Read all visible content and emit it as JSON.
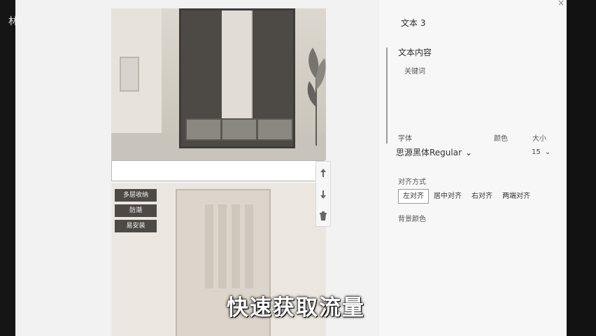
{
  "corner_text": "林杉",
  "panel": {
    "title": "文本 3",
    "content_section": "文本内容",
    "content_value": "关键词",
    "font_label": "字体",
    "color_label": "颜色",
    "size_label": "大小",
    "font_value": "思源黑体Regular",
    "size_value": "15",
    "align_label": "对齐方式",
    "align_options": [
      "左对齐",
      "居中对齐",
      "右对齐",
      "两端对齐"
    ],
    "background_label": "背景颜色"
  },
  "image_tags": [
    "多层收纳",
    "防潮",
    "易安装"
  ],
  "caption": "快速获取流量",
  "icons": {
    "close": "close-icon",
    "up": "up-arrow-icon",
    "down": "down-arrow-icon",
    "delete": "trash-icon",
    "font_dropdown": "chevron-down-icon",
    "size_dropdown": "chevron-down-icon"
  }
}
